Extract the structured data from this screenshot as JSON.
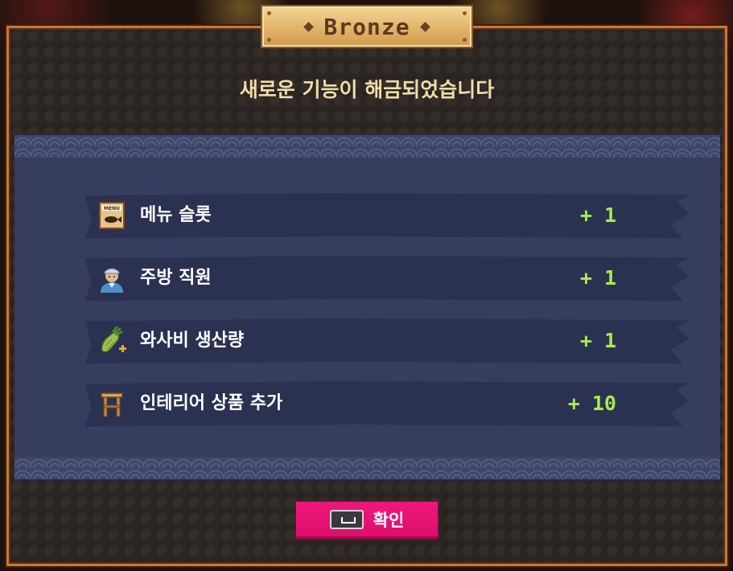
{
  "badge": {
    "title": "Bronze"
  },
  "subtitle": "새로운 기능이 해금되었습니다",
  "rewards": [
    {
      "icon": "menu-board-icon",
      "label": "메뉴 슬롯",
      "value": "+ 1"
    },
    {
      "icon": "chef-icon",
      "label": "주방 직원",
      "value": "+ 1"
    },
    {
      "icon": "wasabi-plus-icon",
      "label": "와사비 생산량",
      "value": "+ 1"
    },
    {
      "icon": "stool-icon",
      "label": "인테리어 상품 추가",
      "value": "+ 10"
    }
  ],
  "confirm": {
    "key_icon": "spacebar-key-icon",
    "label": "확인"
  },
  "colors": {
    "accent_value": "#a6ec4c",
    "confirm_button": "#e8126f",
    "badge_gold": "#e1b469"
  }
}
